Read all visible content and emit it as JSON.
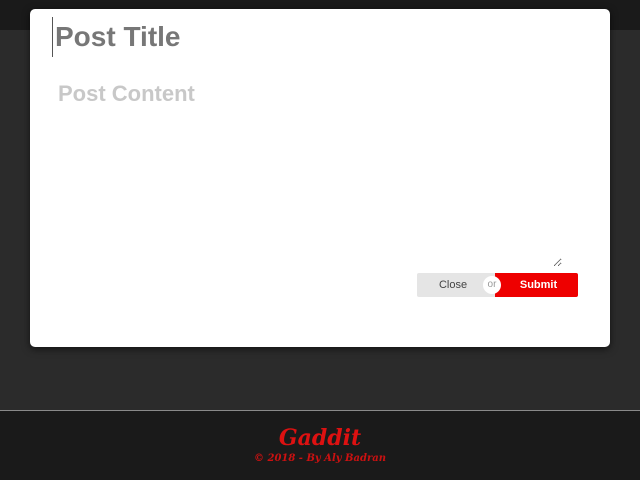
{
  "modal": {
    "title_placeholder": "Post Title",
    "content_placeholder": "Post Content",
    "close_label": "Close",
    "or_label": "or",
    "submit_label": "Submit"
  },
  "footer": {
    "brand": "Gaddit",
    "copyright": "© 2018 - By Aly Badran"
  },
  "colors": {
    "accent": "#ee0000",
    "background": "#2b2b2b",
    "footer": "#1a1a1a"
  }
}
